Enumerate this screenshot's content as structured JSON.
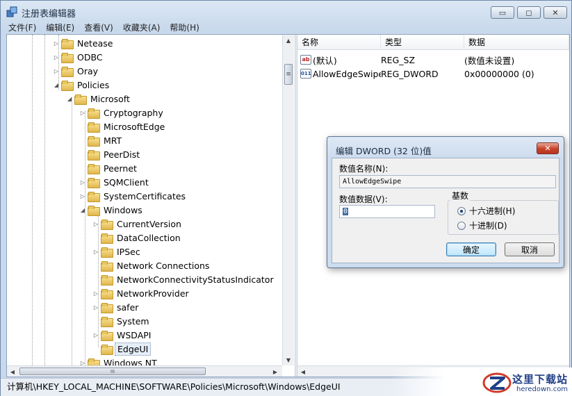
{
  "window": {
    "title": "注册表编辑器",
    "minimize_glyph": "▭",
    "maximize_glyph": "◻",
    "close_glyph": "✕"
  },
  "menu": [
    "文件(F)",
    "编辑(E)",
    "查看(V)",
    "收藏夹(A)",
    "帮助(H)"
  ],
  "tree": [
    {
      "label": "Netease",
      "expander": "▷"
    },
    {
      "label": "ODBC",
      "expander": "▷"
    },
    {
      "label": "Oray",
      "expander": "▷"
    },
    {
      "label": "Policies",
      "expander": "◢"
    },
    {
      "label": "Microsoft",
      "expander": "◢"
    },
    {
      "label": "Cryptography",
      "expander": "▷"
    },
    {
      "label": "MicrosoftEdge",
      "expander": ""
    },
    {
      "label": "MRT",
      "expander": ""
    },
    {
      "label": "PeerDist",
      "expander": ""
    },
    {
      "label": "Peernet",
      "expander": ""
    },
    {
      "label": "SQMClient",
      "expander": "▷"
    },
    {
      "label": "SystemCertificates",
      "expander": "▷"
    },
    {
      "label": "Windows",
      "expander": "◢"
    },
    {
      "label": "CurrentVersion",
      "expander": "▷"
    },
    {
      "label": "DataCollection",
      "expander": ""
    },
    {
      "label": "IPSec",
      "expander": "▷"
    },
    {
      "label": "Network Connections",
      "expander": ""
    },
    {
      "label": "NetworkConnectivityStatusIndicator",
      "expander": ""
    },
    {
      "label": "NetworkProvider",
      "expander": "▷"
    },
    {
      "label": "safer",
      "expander": "▷"
    },
    {
      "label": "System",
      "expander": ""
    },
    {
      "label": "WSDAPI",
      "expander": "▷"
    },
    {
      "label": "EdgeUI",
      "expander": ""
    },
    {
      "label": "Windows NT",
      "expander": "▷"
    }
  ],
  "scroll": {
    "up": "▲",
    "down": "▼",
    "left": "◀",
    "right": "▶",
    "grip": "III",
    "vgrip": "≡"
  },
  "list": {
    "columns": [
      "名称",
      "类型",
      "数据"
    ],
    "rows": [
      {
        "icon": "ab",
        "name": "(默认)",
        "type": "REG_SZ",
        "data": "(数值未设置)"
      },
      {
        "icon": "011",
        "name": "AllowEdgeSwipe",
        "type": "REG_DWORD",
        "data": "0x00000000 (0)"
      }
    ]
  },
  "status": {
    "path": "计算机\\HKEY_LOCAL_MACHINE\\SOFTWARE\\Policies\\Microsoft\\Windows\\EdgeUI"
  },
  "dialog": {
    "title": "编辑 DWORD (32 位)值",
    "close_glyph": "✕",
    "name_label": "数值名称(N):",
    "name_value": "AllowEdgeSwipe",
    "data_label": "数值数据(V):",
    "data_value": "0",
    "base_label": "基数",
    "radio_hex": "十六进制(H)",
    "radio_dec": "十进制(D)",
    "selected_base": "hex",
    "ok_label": "确定",
    "cancel_label": "取消"
  },
  "watermark": {
    "text": "这里下载站",
    "sub": "heredown.com"
  },
  "colors": {
    "accent": "#3c7fb1",
    "selection": "#3a6ea5"
  }
}
